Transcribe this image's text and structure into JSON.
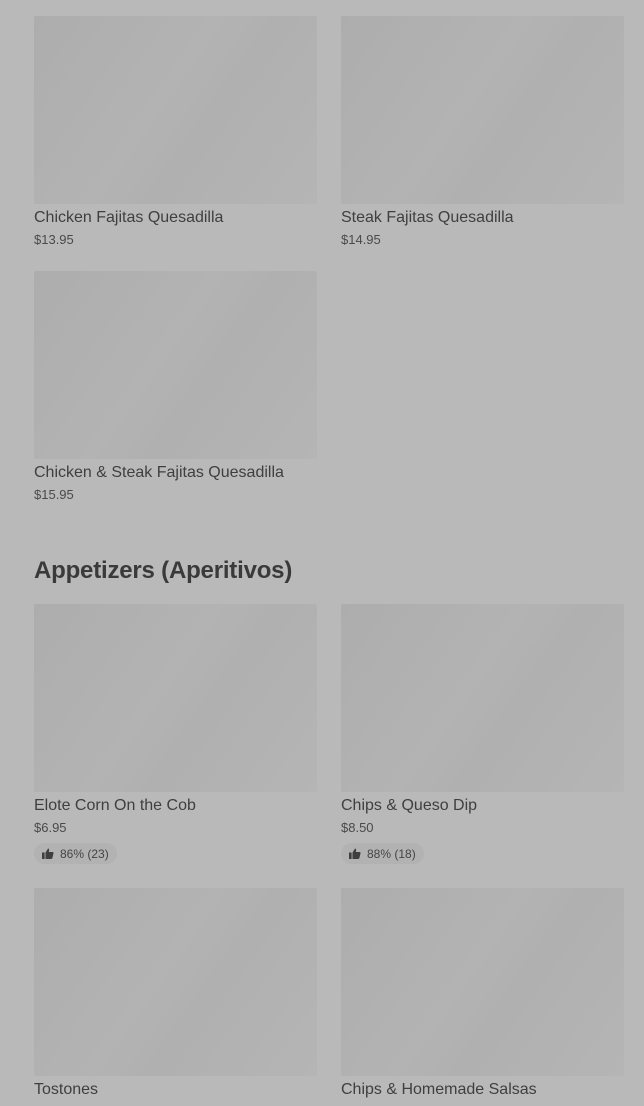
{
  "quesadillas": {
    "items": [
      {
        "name": "Chicken Fajitas Quesadilla",
        "price": "$13.95"
      },
      {
        "name": "Steak Fajitas Quesadilla",
        "price": "$14.95"
      },
      {
        "name": "Chicken & Steak Fajitas Quesadilla",
        "price": "$15.95"
      }
    ]
  },
  "appetizers": {
    "title": "Appetizers (Aperitivos)",
    "items": [
      {
        "name": "Elote Corn On the Cob",
        "price": "$6.95",
        "rating": "86% (23)"
      },
      {
        "name": "Chips & Queso Dip",
        "price": "$8.50",
        "rating": "88% (18)"
      },
      {
        "name": "Tostones",
        "price": ""
      },
      {
        "name": "Chips & Homemade Salsas",
        "price": ""
      }
    ]
  },
  "icons": {
    "rating": "thumbs-up-icon"
  }
}
